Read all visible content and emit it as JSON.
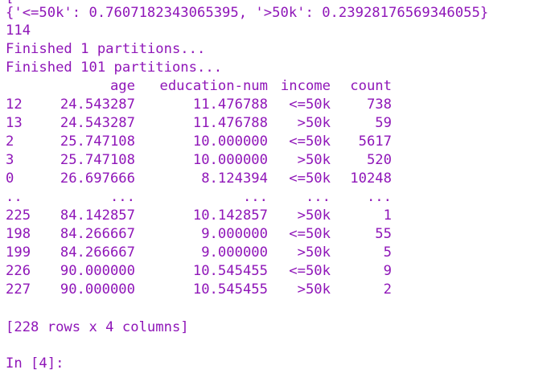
{
  "console": {
    "clipped_line": "[",
    "dict_line": "{'<=50k': 0.7607182343065395, '>50k': 0.23928176569346055}",
    "count_line": "114",
    "status_1": "Finished 1 partitions...",
    "status_2": "Finished 101 partitions...",
    "table": {
      "headers": {
        "index": "",
        "age": "age",
        "education": "education-num",
        "income": "income",
        "count": "count"
      },
      "rows": [
        {
          "index": "12",
          "age": "24.543287",
          "education": "11.476788",
          "income": "<=50k",
          "count": "738"
        },
        {
          "index": "13",
          "age": "24.543287",
          "education": "11.476788",
          "income": ">50k",
          "count": "59"
        },
        {
          "index": "2",
          "age": "25.747108",
          "education": "10.000000",
          "income": "<=50k",
          "count": "5617"
        },
        {
          "index": "3",
          "age": "25.747108",
          "education": "10.000000",
          "income": ">50k",
          "count": "520"
        },
        {
          "index": "0",
          "age": "26.697666",
          "education": "8.124394",
          "income": "<=50k",
          "count": "10248"
        },
        {
          "index": "..",
          "age": "...",
          "education": "...",
          "income": "...",
          "count": "..."
        },
        {
          "index": "225",
          "age": "84.142857",
          "education": "10.142857",
          "income": ">50k",
          "count": "1"
        },
        {
          "index": "198",
          "age": "84.266667",
          "education": "9.000000",
          "income": "<=50k",
          "count": "55"
        },
        {
          "index": "199",
          "age": "84.266667",
          "education": "9.000000",
          "income": ">50k",
          "count": "5"
        },
        {
          "index": "226",
          "age": "90.000000",
          "education": "10.545455",
          "income": "<=50k",
          "count": "9"
        },
        {
          "index": "227",
          "age": "90.000000",
          "education": "10.545455",
          "income": ">50k",
          "count": "2"
        }
      ],
      "summary": "[228 rows x 4 columns]"
    },
    "prompt": {
      "label": "In [",
      "number": "4",
      "suffix": "]:"
    }
  },
  "colors": {
    "text": "#8f16b8",
    "background": "#ffffff"
  }
}
